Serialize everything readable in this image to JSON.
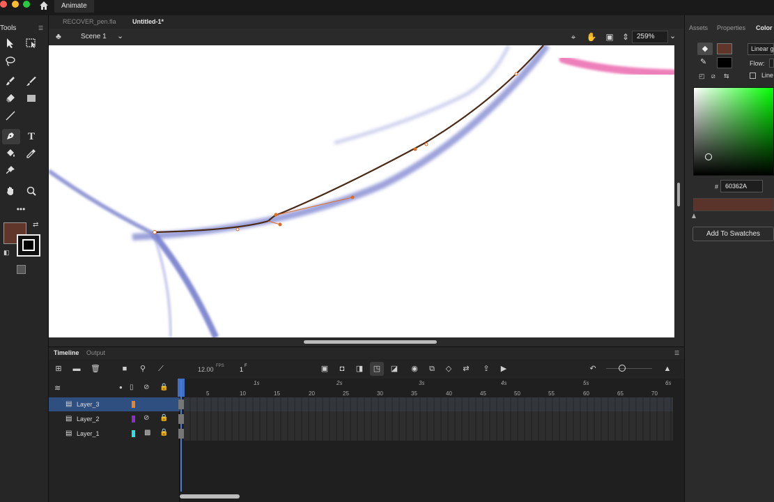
{
  "app": {
    "tab_label": "Animate"
  },
  "documents": {
    "tabs": [
      "RECOVER_pen.fla",
      "Untitled-1*"
    ]
  },
  "tools": {
    "title": "Tools"
  },
  "stage": {
    "scene_label": "Scene 1",
    "zoom_value": "259%"
  },
  "right_panel": {
    "tabs": [
      "Assets",
      "Properties",
      "Color"
    ],
    "gradient_type": "Linear g",
    "flow_label": "Flow:",
    "line_label": "Line",
    "hex_hash": "#",
    "hex_value": "60362A",
    "add_swatches_label": "Add To Swatches",
    "fill_color": "#60362A",
    "stroke_color": "#000000"
  },
  "timeline": {
    "tabs": [
      "Timeline",
      "Output"
    ],
    "fps_value": "12.00",
    "fps_label": "FPS",
    "frame_value": "1",
    "frame_label": "F",
    "ruler_frames": [
      "5",
      "10",
      "15",
      "20",
      "25",
      "30",
      "35",
      "40",
      "45",
      "50",
      "55",
      "60",
      "65",
      "70"
    ],
    "ruler_seconds": [
      "1s",
      "2s",
      "3s",
      "4s",
      "5s",
      "6s"
    ],
    "layers": [
      {
        "name": "Layer_3",
        "color": "#e8852a",
        "selected": true
      },
      {
        "name": "Layer_2",
        "color": "#8a2fc8",
        "selected": false
      },
      {
        "name": "Layer_1",
        "color": "#2de0e8",
        "selected": false
      }
    ]
  }
}
